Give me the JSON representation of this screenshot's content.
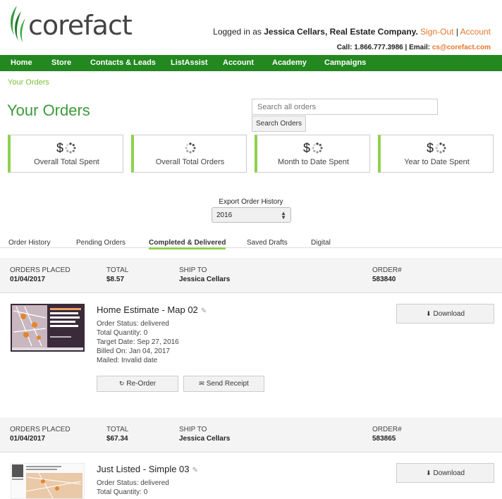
{
  "header": {
    "logo_text": "corefact",
    "logged_in_prefix": "Logged in as",
    "user": "Jessica Cellars, Real Estate Company.",
    "sign_out": "Sign-Out",
    "separator": "|",
    "account_link": "Account",
    "call": "Call: 1.866.777.3986 | Email:",
    "email": "cs@corefact.com"
  },
  "nav": [
    "Home",
    "Store",
    "Contacts & Leads",
    "ListAssist",
    "Account",
    "Academy",
    "Campaigns"
  ],
  "breadcrumb": "Your Orders",
  "page_title": "Your Orders",
  "search": {
    "placeholder": "Search all orders",
    "button": "Search Orders"
  },
  "stats": [
    {
      "prefix": "$",
      "label": "Overall Total Spent"
    },
    {
      "prefix": "",
      "label": "Overall Total Orders"
    },
    {
      "prefix": "$",
      "label": "Month to Date Spent"
    },
    {
      "prefix": "$",
      "label": "Year to Date Spent"
    }
  ],
  "export": {
    "label": "Export Order History",
    "selected": "2016"
  },
  "tabs": [
    "Order History",
    "Pending Orders",
    "Completed & Delivered",
    "Saved Drafts",
    "Digital"
  ],
  "active_tab": "Completed & Delivered",
  "order_labels": {
    "placed": "Orders Placed",
    "total": "Total",
    "ship": "Ship To",
    "order": "Order#"
  },
  "orders": [
    {
      "placed": "01/04/2017",
      "total": "$8.57",
      "ship_to": "Jessica Cellars",
      "order_no": "583840",
      "title": "Home Estimate - Map 02",
      "status": "Order Status: delivered",
      "quantity": "Total Quantity: 0",
      "target": "Target Date: Sep 27, 2016",
      "billed": "Billed On: Jan 04, 2017",
      "mailed": "Mailed: Invalid date",
      "reorder": "Re-Order",
      "receipt": "Send Receipt",
      "download": "Download"
    },
    {
      "placed": "01/04/2017",
      "total": "$67.34",
      "ship_to": "Jessica Cellars",
      "order_no": "583865",
      "title": "Just Listed - Simple 03",
      "status": "Order Status: delivered",
      "quantity": "Total Quantity: 0",
      "download": "Download"
    }
  ],
  "colors": {
    "nav": "#22881f",
    "accent": "#8fd14f",
    "title": "#3d9a3a",
    "link": "#e8762c"
  }
}
